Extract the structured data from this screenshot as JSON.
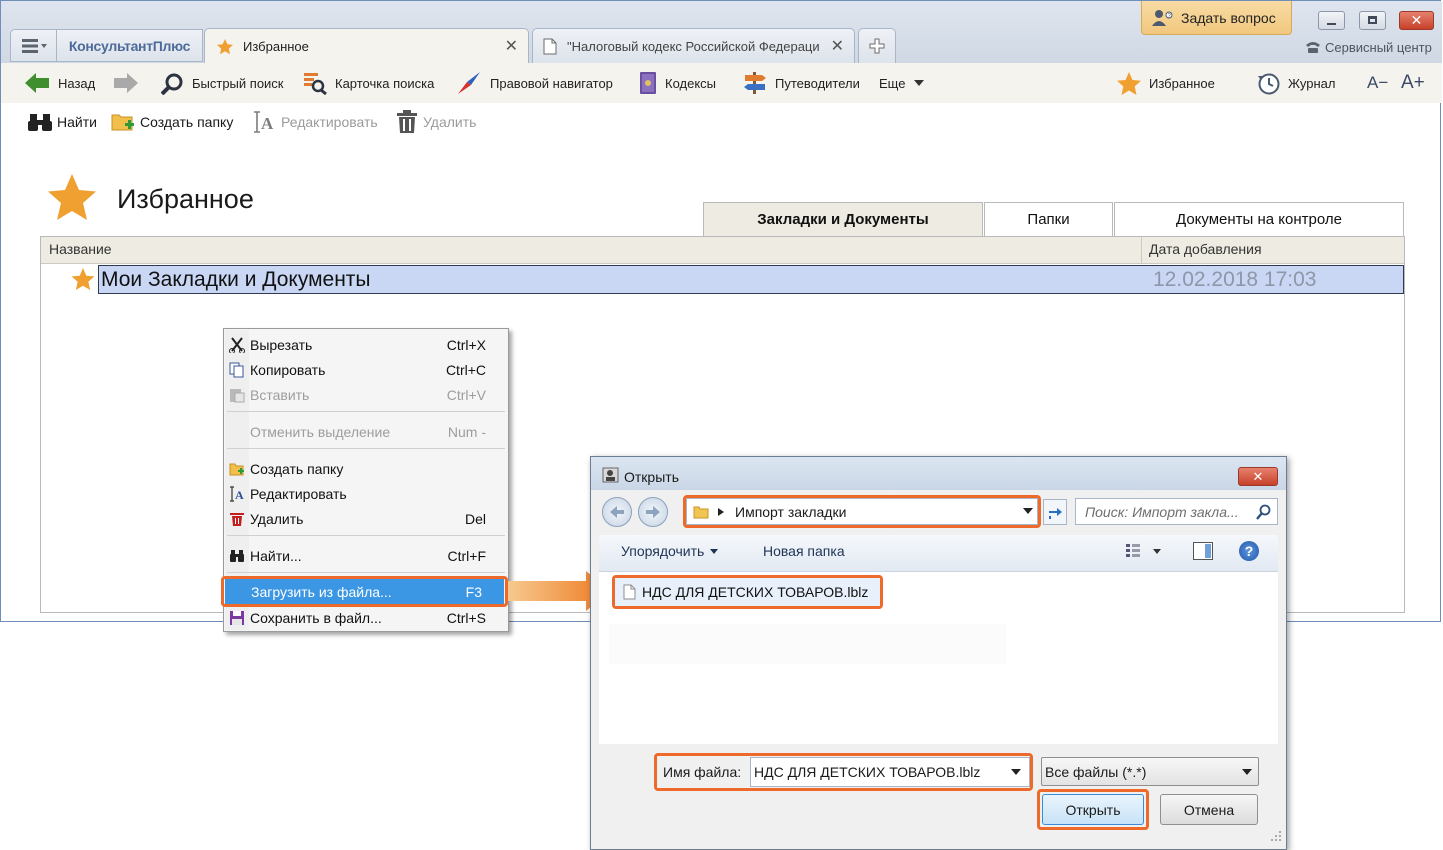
{
  "titlebar": {
    "logo": "КонсультантПлюс",
    "tabs": [
      {
        "label": "Избранное",
        "icon": "star-icon"
      },
      {
        "label": "\"Налоговый кодекс Российской Федерации",
        "icon": "document-icon"
      }
    ],
    "ask_button": "Задать вопрос",
    "service_center": "Сервисный центр"
  },
  "toolbar": {
    "back": "Назад",
    "quick_search": "Быстрый поиск",
    "search_card": "Карточка поиска",
    "legal_navigator": "Правовой навигатор",
    "codes": "Кодексы",
    "guides": "Путеводители",
    "more": "Еще",
    "favorites": "Избранное",
    "journal": "Журнал",
    "font_smaller": "A−",
    "font_larger": "A+"
  },
  "actions": {
    "find": "Найти",
    "create_folder": "Создать папку",
    "edit": "Редактировать",
    "delete": "Удалить"
  },
  "page": {
    "title": "Избранное",
    "tabs": [
      "Закладки и Документы",
      "Папки",
      "Документы на контроле"
    ],
    "columns": {
      "name": "Название",
      "date": "Дата добавления"
    },
    "rows": [
      {
        "name": "Мои Закладки и Документы",
        "date": "12.02.2018 17:03"
      }
    ]
  },
  "context_menu": {
    "items": [
      {
        "label": "Вырезать",
        "shortcut": "Ctrl+X"
      },
      {
        "label": "Копировать",
        "shortcut": "Ctrl+C"
      },
      {
        "label": "Вставить",
        "shortcut": "Ctrl+V"
      },
      {
        "label": "Отменить выделение",
        "shortcut": "Num -"
      },
      {
        "label": "Создать папку",
        "shortcut": ""
      },
      {
        "label": "Редактировать",
        "shortcut": ""
      },
      {
        "label": "Удалить",
        "shortcut": "Del"
      },
      {
        "label": "Найти...",
        "shortcut": "Ctrl+F"
      },
      {
        "label": "Загрузить из файла...",
        "shortcut": "F3"
      },
      {
        "label": "Сохранить в файл...",
        "shortcut": "Ctrl+S"
      }
    ]
  },
  "dialog": {
    "title": "Открыть",
    "path": "Импорт закладки",
    "search_placeholder": "Поиск: Импорт закла...",
    "organize": "Упорядочить",
    "new_folder": "Новая папка",
    "file_item": "НДС ДЛЯ ДЕТСКИХ ТОВАРОВ.lblz",
    "filename_label": "Имя файла:",
    "filename_value": "НДС ДЛЯ ДЕТСКИХ ТОВАРОВ.lblz",
    "file_type": "Все файлы (*.*)",
    "open_button": "Открыть",
    "cancel_button": "Отмена"
  },
  "colors": {
    "accent_orange": "#ee6a2b",
    "selection_blue": "#c9d7f5",
    "menu_highlight": "#3b97e3",
    "star": "#f0a030"
  }
}
